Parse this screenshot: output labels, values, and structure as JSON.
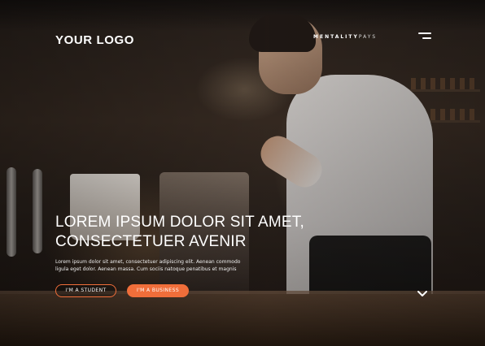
{
  "header": {
    "logo": "YOUR LOGO",
    "brand_primary": "MENTALITY",
    "brand_secondary": "PAYS",
    "menu_icon": "hamburger-menu-icon"
  },
  "hero": {
    "headline_line1": "LOREM IPSUM DOLOR SIT AMET,",
    "headline_line2": "CONSECTETUER AVENIR",
    "paragraph_line1": "Lorem ipsum dolor sit amet, consectetuer adipiscing elit. Aenean commodo",
    "paragraph_line2": "ligula eget dolor. Aenean massa. Cum sociis natoque penatibus et magnis",
    "buttons": {
      "student": "I'M A STUDENT",
      "business": "I'M A BUSINESS"
    },
    "scroll_icon": "chevron-down-icon",
    "background": "barista-pouring-coffee-photo"
  },
  "colors": {
    "accent": "#f06e3a",
    "text": "#ffffff"
  }
}
